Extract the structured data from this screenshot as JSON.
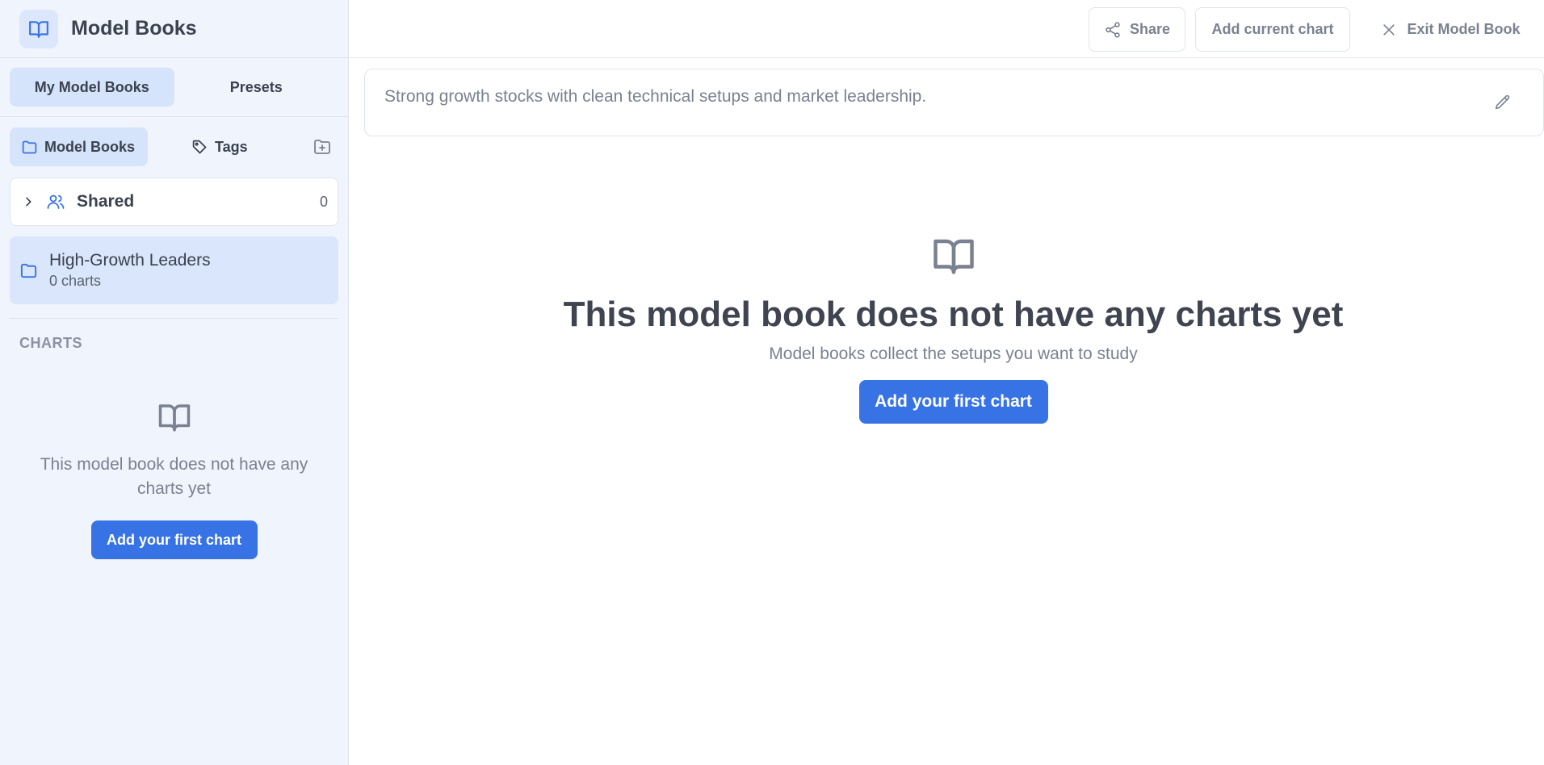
{
  "sidebar": {
    "title": "Model Books",
    "top_tabs": [
      {
        "label": "My Model Books",
        "active": true
      },
      {
        "label": "Presets",
        "active": false
      }
    ],
    "sub_tabs": [
      {
        "label": "Model Books",
        "icon": "folder-icon",
        "active": true
      },
      {
        "label": "Tags",
        "icon": "tag-icon",
        "active": false
      }
    ],
    "shared": {
      "label": "Shared",
      "count": "0"
    },
    "books": [
      {
        "name": "High-Growth Leaders",
        "count_label": "0 charts"
      }
    ],
    "charts_section_label": "CHARTS",
    "empty_text": "This model book does not have any charts yet",
    "empty_button": "Add your first chart"
  },
  "toolbar": {
    "share_label": "Share",
    "add_current_label": "Add current chart",
    "exit_label": "Exit Model Book"
  },
  "description": "Strong growth stocks with clean technical setups and market leadership.",
  "main": {
    "empty_title": "This model book does not have any charts yet",
    "empty_subtitle": "Model books collect the setups you want to study",
    "empty_button": "Add your first chart"
  },
  "colors": {
    "accent": "#3873e6",
    "sidebar_bg": "#f0f4fc",
    "active_bg": "#d5e3fb",
    "icon_gray": "#7a8190"
  }
}
